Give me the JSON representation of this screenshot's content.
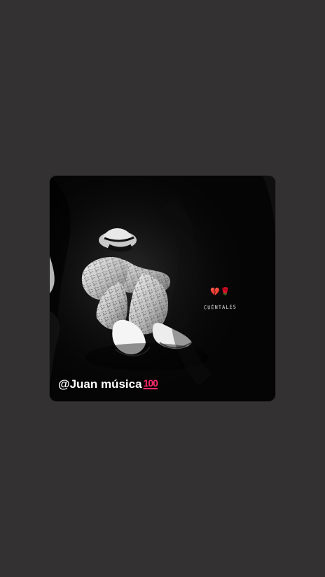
{
  "story": {
    "caption": "@Juan música",
    "caption_emoji": "100",
    "heart_emoji": "💔",
    "rose_emoji": "🌹",
    "overlay_text": "CUÉNTALES"
  },
  "colors": {
    "background": "#333132",
    "card": "#050505",
    "text": "#ffffff",
    "accent": "#ff2b6b"
  },
  "icons": {
    "broken-heart": "broken-heart-icon",
    "rose": "rose-icon",
    "hundred": "hundred-points-icon"
  }
}
